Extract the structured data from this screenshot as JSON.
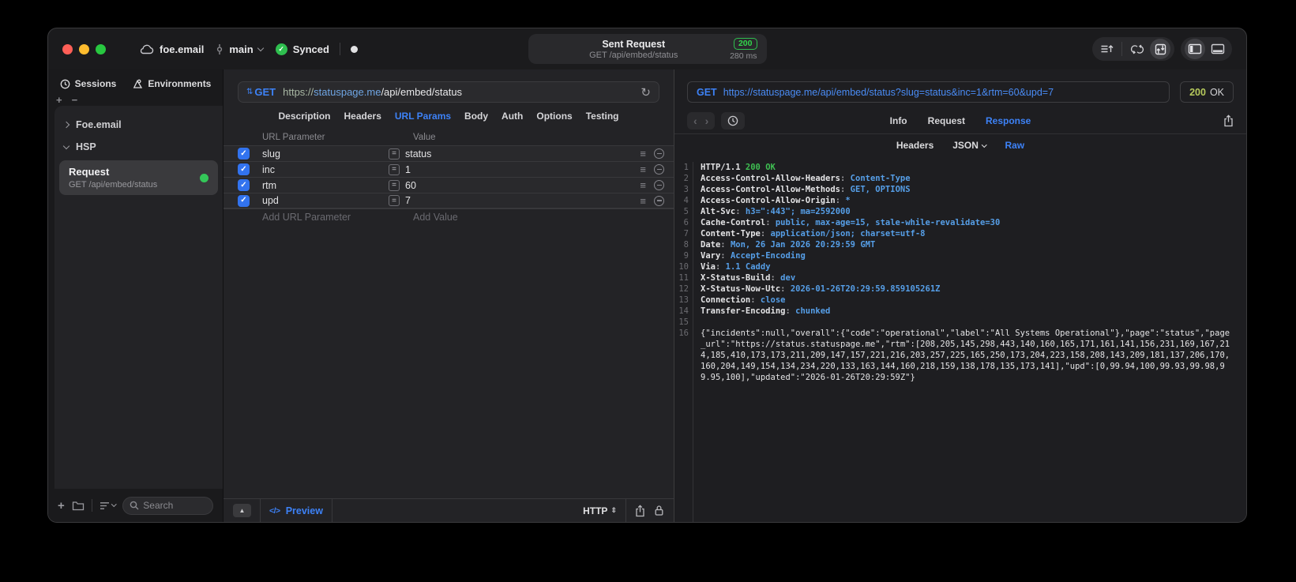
{
  "titlebar": {
    "project": "foe.email",
    "branch": "main",
    "sync_label": "Synced",
    "sent_request": {
      "title": "Sent Request",
      "subtitle": "GET /api/embed/status",
      "status_code": "200",
      "duration": "280 ms"
    }
  },
  "sidebar": {
    "tabs": [
      {
        "label": "Sessions"
      },
      {
        "label": "Environments"
      }
    ],
    "groups": [
      {
        "label": "Foe.email"
      },
      {
        "label": "HSP"
      }
    ],
    "request_item": {
      "title": "Request",
      "subtitle": "GET /api/embed/status"
    },
    "search_placeholder": "Search"
  },
  "request_panel": {
    "method": "GET",
    "url": {
      "scheme": "https://",
      "host": "statuspage.me",
      "path": "/api/embed/status"
    },
    "tabs": [
      {
        "label": "Description"
      },
      {
        "label": "Headers"
      },
      {
        "label": "URL Params",
        "active": true
      },
      {
        "label": "Body"
      },
      {
        "label": "Auth"
      },
      {
        "label": "Options"
      },
      {
        "label": "Testing"
      }
    ],
    "param_table": {
      "name_header": "URL Parameter",
      "value_header": "Value",
      "rows": [
        {
          "name": "slug",
          "value": "status"
        },
        {
          "name": "inc",
          "value": "1"
        },
        {
          "name": "rtm",
          "value": "60"
        },
        {
          "name": "upd",
          "value": "7"
        }
      ],
      "add_name_placeholder": "Add URL Parameter",
      "add_value_placeholder": "Add Value"
    },
    "footer": {
      "preview_glyph": "</>",
      "preview_label": "Preview",
      "protocol_label": "HTTP"
    }
  },
  "response_panel": {
    "method": "GET",
    "url": "https://statuspage.me/api/embed/status?slug=status&inc=1&rtm=60&upd=7",
    "status_code": "200",
    "status_text": "OK",
    "tabs": [
      {
        "label": "Info"
      },
      {
        "label": "Request"
      },
      {
        "label": "Response",
        "active": true
      }
    ],
    "subtabs": [
      {
        "label": "Headers"
      },
      {
        "label": "JSON",
        "dropdown": true
      },
      {
        "label": "Raw",
        "active": true
      }
    ],
    "body_lines": [
      {
        "n": "1",
        "parts": [
          [
            "name",
            "HTTP/1.1 "
          ],
          [
            "green",
            "200 OK"
          ]
        ]
      },
      {
        "n": "2",
        "parts": [
          [
            "name",
            "Access-Control-Allow-Headers"
          ],
          [
            "dim",
            ": "
          ],
          [
            "val",
            "Content-Type"
          ]
        ]
      },
      {
        "n": "3",
        "parts": [
          [
            "name",
            "Access-Control-Allow-Methods"
          ],
          [
            "dim",
            ": "
          ],
          [
            "val",
            "GET, OPTIONS"
          ]
        ]
      },
      {
        "n": "4",
        "parts": [
          [
            "name",
            "Access-Control-Allow-Origin"
          ],
          [
            "dim",
            ": "
          ],
          [
            "val",
            "*"
          ]
        ]
      },
      {
        "n": "5",
        "parts": [
          [
            "name",
            "Alt-Svc"
          ],
          [
            "dim",
            ": "
          ],
          [
            "val",
            "h3=\":443\"; ma=2592000"
          ]
        ]
      },
      {
        "n": "6",
        "parts": [
          [
            "name",
            "Cache-Control"
          ],
          [
            "dim",
            ": "
          ],
          [
            "val",
            "public, max-age=15, stale-while-revalidate=30"
          ]
        ]
      },
      {
        "n": "7",
        "parts": [
          [
            "name",
            "Content-Type"
          ],
          [
            "dim",
            ": "
          ],
          [
            "val",
            "application/json; charset=utf-8"
          ]
        ]
      },
      {
        "n": "8",
        "parts": [
          [
            "name",
            "Date"
          ],
          [
            "dim",
            ": "
          ],
          [
            "val",
            "Mon, 26 Jan 2026 20:29:59 GMT"
          ]
        ]
      },
      {
        "n": "9",
        "parts": [
          [
            "name",
            "Vary"
          ],
          [
            "dim",
            ": "
          ],
          [
            "val",
            "Accept-Encoding"
          ]
        ]
      },
      {
        "n": "10",
        "parts": [
          [
            "name",
            "Via"
          ],
          [
            "dim",
            ": "
          ],
          [
            "val",
            "1.1 Caddy"
          ]
        ]
      },
      {
        "n": "11",
        "parts": [
          [
            "name",
            "X-Status-Build"
          ],
          [
            "dim",
            ": "
          ],
          [
            "val",
            "dev"
          ]
        ]
      },
      {
        "n": "12",
        "parts": [
          [
            "name",
            "X-Status-Now-Utc"
          ],
          [
            "dim",
            ": "
          ],
          [
            "val",
            "2026-01-26T20:29:59.859105261Z"
          ]
        ]
      },
      {
        "n": "13",
        "parts": [
          [
            "name",
            "Connection"
          ],
          [
            "dim",
            ": "
          ],
          [
            "val",
            "close"
          ]
        ]
      },
      {
        "n": "14",
        "parts": [
          [
            "name",
            "Transfer-Encoding"
          ],
          [
            "dim",
            ": "
          ],
          [
            "val",
            "chunked"
          ]
        ]
      },
      {
        "n": "15",
        "parts": []
      },
      {
        "n": "16",
        "parts": [
          [
            "plain",
            "{\"incidents\":null,\"overall\":{\"code\":\"operational\",\"label\":\"All Systems Operational\"},\"page\":\"status\",\"page_url\":\"https://status.statuspage.me\",\"rtm\":[208,205,145,298,443,140,160,165,171,161,141,156,231,169,167,214,185,410,173,173,211,209,147,157,221,216,203,257,225,165,250,173,204,223,158,208,143,209,181,137,206,170,160,204,149,154,134,234,220,133,163,144,160,218,159,138,178,135,173,141],\"upd\":[0,99.94,100,99.93,99.98,99.95,100],\"updated\":\"2026-01-26T20:29:59Z\"}"
          ]
        ]
      }
    ]
  },
  "icons": {
    "check": "✓",
    "equals": "=",
    "reorder": "≡",
    "method_sort": "⇅",
    "refresh": "↻",
    "expand": "▲",
    "back": "‹",
    "forward": "›",
    "plus": "+",
    "minus": "−",
    "updown": "⇕"
  },
  "colors": {
    "accent_blue": "#3d82f7",
    "badge_green": "#32d74b",
    "status_green": "#b6c95c"
  }
}
